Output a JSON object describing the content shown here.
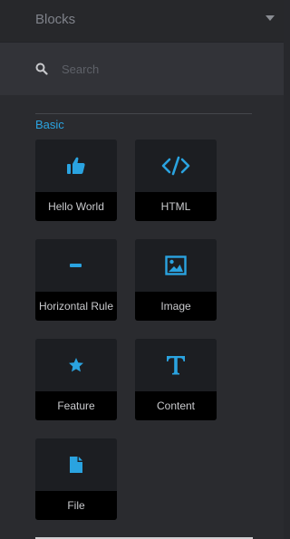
{
  "header": {
    "title": "Blocks"
  },
  "search": {
    "placeholder": "Search",
    "value": ""
  },
  "category": {
    "title": "Basic"
  },
  "blocks": [
    {
      "label": "Hello World",
      "icon": "thumbs-up-icon"
    },
    {
      "label": "HTML",
      "icon": "code-icon"
    },
    {
      "label": "Horizontal Rule",
      "icon": "horizontal-rule-icon"
    },
    {
      "label": "Image",
      "icon": "image-icon"
    },
    {
      "label": "Feature",
      "icon": "star-icon"
    },
    {
      "label": "Content",
      "icon": "text-icon"
    },
    {
      "label": "File",
      "icon": "file-icon"
    }
  ],
  "colors": {
    "accent": "#2aa3e0",
    "background": "#2a2b2f",
    "tile": "#1c1d21",
    "tile_label_bg": "#000000"
  }
}
